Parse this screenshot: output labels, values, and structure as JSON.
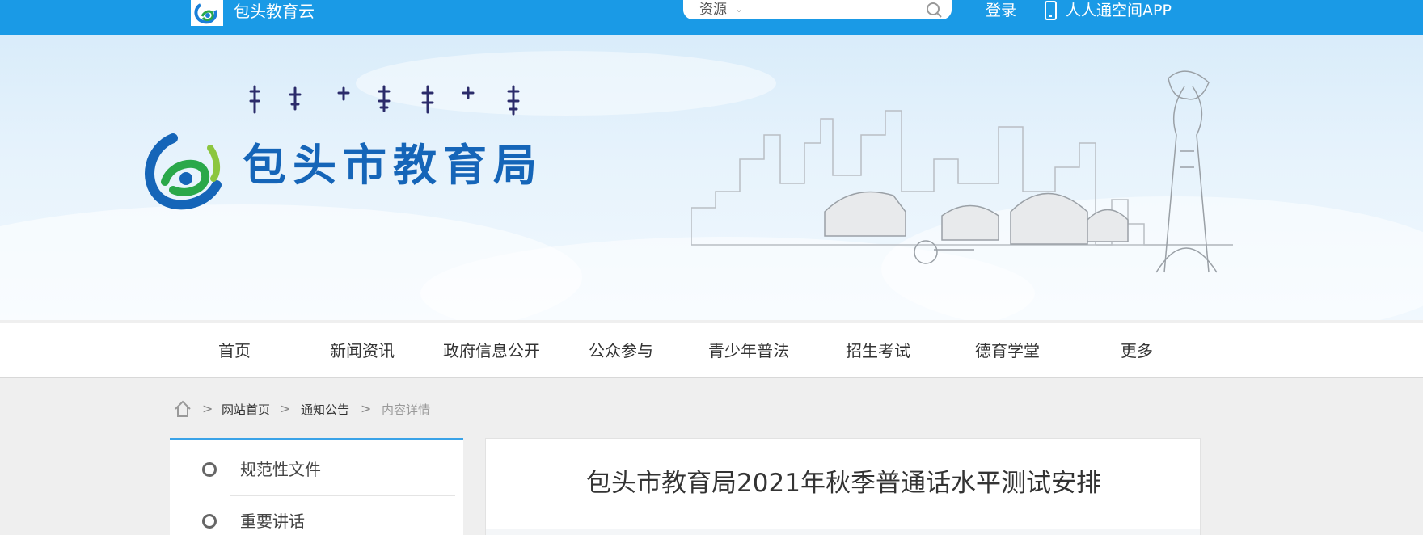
{
  "topbar": {
    "site_name": "包头教育云",
    "search": {
      "type_label": "资源",
      "placeholder": ""
    },
    "login": "登录",
    "app_link": "人人通空间APP"
  },
  "banner": {
    "title": "包头市教育局",
    "mongolian_text": "ᠪᠤᠭᠤᠲᠤ ᠬᠣᠲᠠ"
  },
  "nav": {
    "items": [
      {
        "label": "首页"
      },
      {
        "label": "新闻资讯"
      },
      {
        "label": "政府信息公开"
      },
      {
        "label": "公众参与"
      },
      {
        "label": "青少年普法"
      },
      {
        "label": "招生考试"
      },
      {
        "label": "德育学堂"
      },
      {
        "label": "更多"
      }
    ]
  },
  "breadcrumb": {
    "items": [
      "网站首页",
      "通知公告",
      "内容详情"
    ],
    "separator": ">"
  },
  "sidebar": {
    "items": [
      {
        "label": "规范性文件"
      },
      {
        "label": "重要讲话"
      }
    ]
  },
  "article": {
    "title": "包头市教育局2021年秋季普通话水平测试安排"
  },
  "colors": {
    "topbar": "#1a9ae6",
    "banner_title": "#1565b8",
    "banner_line": "#1a7fd8",
    "sidebar_accent": "#3aa3e8"
  },
  "icons": {
    "logo": "baotou-education-logo-icon",
    "search": "search-icon",
    "phone": "phone-icon",
    "home": "home-icon",
    "caret": "chevron-down-icon",
    "sidebar_bullet": "circle-icon"
  }
}
